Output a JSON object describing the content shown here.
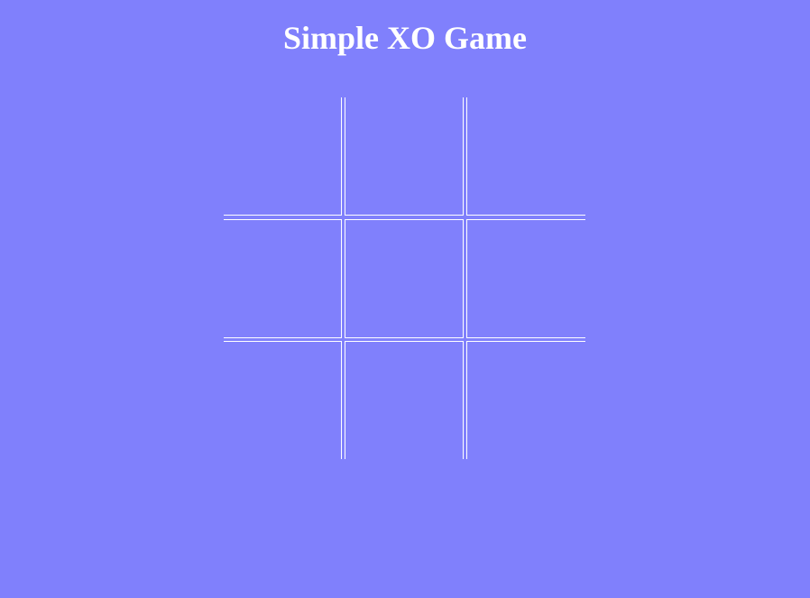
{
  "title": "Simple XO Game",
  "colors": {
    "background": "#8080fc",
    "grid_lines": "#ffffff",
    "title_text": "#ffffff"
  },
  "board": {
    "cells": [
      "",
      "",
      "",
      "",
      "",
      "",
      "",
      "",
      ""
    ]
  }
}
